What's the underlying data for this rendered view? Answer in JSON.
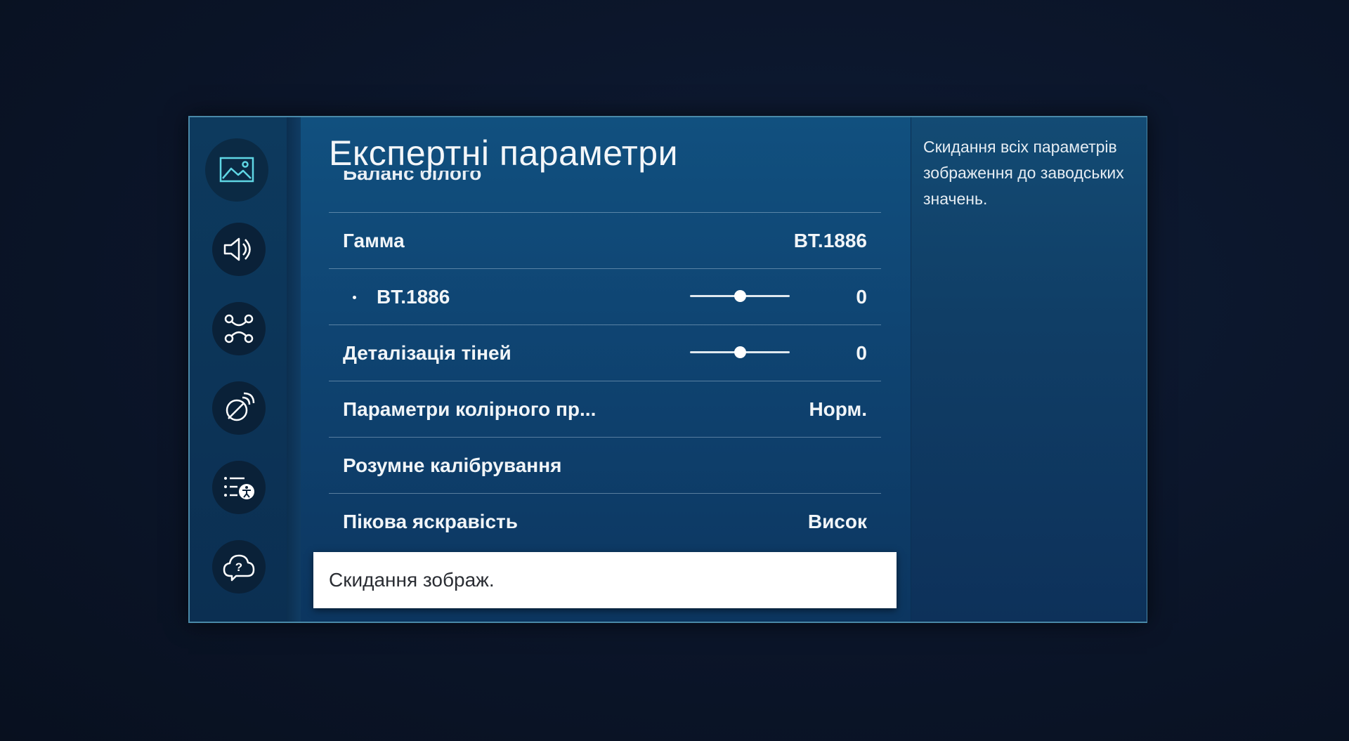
{
  "menu": {
    "title": "Експертні параметри",
    "partial_item": "Баланс білого",
    "items": [
      {
        "label": "Гамма",
        "value": "BT.1886"
      },
      {
        "label": "BT.1886",
        "value": "0",
        "slider_fraction": 0.5
      },
      {
        "label": "Деталізація тіней",
        "value": "0",
        "slider_fraction": 0.5
      },
      {
        "label": "Параметри колірного пр...",
        "value": "Норм."
      },
      {
        "label": "Розумне калібрування",
        "value": ""
      },
      {
        "label": "Пікова яскравість",
        "value": "Висок"
      }
    ],
    "selected_item": "Скидання зображ."
  },
  "help": {
    "text": "Скидання всіх параметрів зображення до заводських значень."
  },
  "sidebar": {
    "icons": [
      "picture-icon",
      "sound-icon",
      "connection-icon",
      "broadcasting-icon",
      "accessibility-icon",
      "support-icon"
    ],
    "active": "picture-icon"
  },
  "colors": {
    "accent": "#4fd0e0",
    "highlight_bg": "#ffffff",
    "panel_blue": "#0f4573"
  }
}
